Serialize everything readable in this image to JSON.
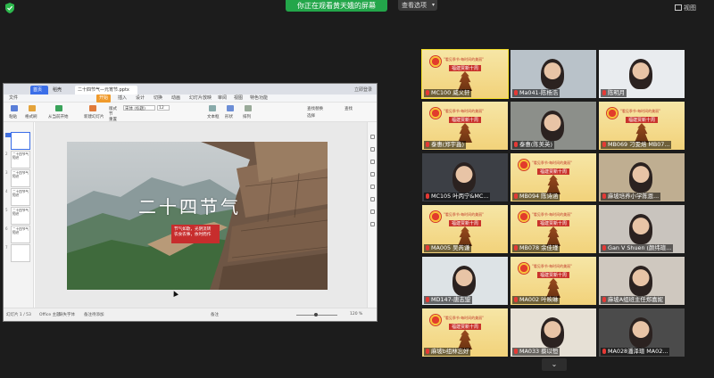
{
  "top": {
    "banner": "你正在观看黄天娥的屏幕",
    "view_options": "查看选项",
    "view_options_caret": "▾",
    "grid_label": "视图"
  },
  "share": {
    "tabs": {
      "home": "首页",
      "doc": "稻壳",
      "file": "二十四节气—元宵节.pptx",
      "login": "立即登录"
    },
    "menus": [
      "文件",
      "开始",
      "插入",
      "设计",
      "切换",
      "动画",
      "幻灯片放映",
      "审阅",
      "视图",
      "特色功能"
    ],
    "active_menu": "开始",
    "ribbon": [
      "粘贴",
      "格式刷",
      "从当前开始",
      "新建幻灯片",
      "版式",
      "节",
      "重置",
      "宋体 (标题)",
      "12",
      "文本框",
      "形状",
      "排列",
      "查找替换",
      "选择",
      "查找"
    ],
    "thumbs": [
      {
        "num": "1",
        "text": ""
      },
      {
        "num": "2",
        "text": "二十四节气知识"
      },
      {
        "num": "3",
        "text": "二十四节气知识"
      },
      {
        "num": "4",
        "text": "二十四节气知识"
      },
      {
        "num": "5",
        "text": "二十四节气知识"
      },
      {
        "num": "6",
        "text": "二十四节气知识"
      },
      {
        "num": "7",
        "text": ""
      }
    ],
    "status": {
      "slide": "幻灯片 1 / 53",
      "theme": "Office 主题",
      "missing_font": "缺失字体",
      "note": "备注待添加",
      "notes": "备注",
      "zoom": "120 %"
    },
    "slide": {
      "title": "二十四节气",
      "box_line1": "节气如歌，光阴流转",
      "box_line2": "农食农事，依时而作"
    }
  },
  "participants": [
    {
      "name": "MC100 威义轩",
      "active": true
    },
    {
      "name": "Ma041-陈杨浩"
    },
    {
      "name": "陈明月"
    },
    {
      "name": "泰惠(郑宇鑫)"
    },
    {
      "name": "泰惠(陈美英)"
    },
    {
      "name": "MB069 刁雯熔 MB07..."
    },
    {
      "name": "MC105 叶丙宁&MC..."
    },
    {
      "name": "MB094 陈诗涵"
    },
    {
      "name": "麻坡培养小学陈恩..."
    },
    {
      "name": "MA005 吴芮谦"
    },
    {
      "name": "MB078 余佳瑾"
    },
    {
      "name": "Gan V Shuen (颜纬瑄..."
    },
    {
      "name": "MD147-唐志盟"
    },
    {
      "name": "MA002 叶映琳"
    },
    {
      "name": "麻坡A组班主任郑嘉妮"
    },
    {
      "name": "麻坡b组林忘好"
    },
    {
      "name": "MA033 蔡以恒"
    },
    {
      "name": "MA028潘泽瑄 MA02..."
    }
  ],
  "poster": {
    "line1": "\"看见季节·每时间的美丽\"",
    "line2": "福建贾新十周"
  },
  "down_button": "⌄"
}
